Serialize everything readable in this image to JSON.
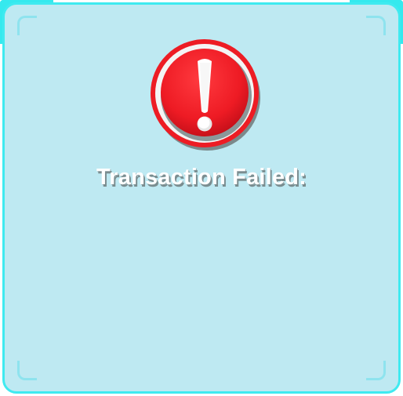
{
  "dialog": {
    "title": "Transaction Failed:",
    "message": "",
    "icon": "exclamation-alert-icon"
  },
  "colors": {
    "panel_background": "#bee9f2",
    "frame_border": "#3feaf0",
    "alert_red": "#ed1c24",
    "title_text": "#ffffff"
  }
}
